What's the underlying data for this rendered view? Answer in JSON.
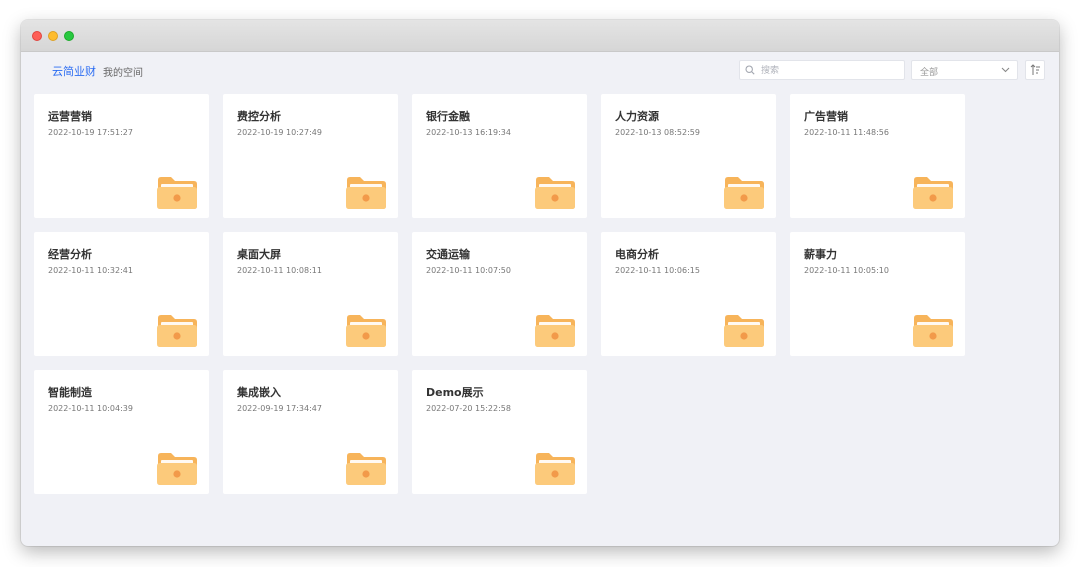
{
  "header": {
    "brand": "云简业财",
    "space": "我的空间",
    "search_placeholder": "搜索",
    "filter_value": "全部"
  },
  "icons": {
    "search": "search-icon",
    "dropdown": "chevron-down-icon",
    "sort": "sort-icon",
    "folder": "folder-icon"
  },
  "colors": {
    "brand": "#2c6df2",
    "folder": "#fbc56f"
  },
  "folders": [
    {
      "name": "运营营销",
      "time": "2022-10-19 17:51:27"
    },
    {
      "name": "费控分析",
      "time": "2022-10-19 10:27:49"
    },
    {
      "name": "银行金融",
      "time": "2022-10-13 16:19:34"
    },
    {
      "name": "人力资源",
      "time": "2022-10-13 08:52:59"
    },
    {
      "name": "广告营销",
      "time": "2022-10-11 11:48:56"
    },
    {
      "name": "经营分析",
      "time": "2022-10-11 10:32:41"
    },
    {
      "name": "桌面大屏",
      "time": "2022-10-11 10:08:11"
    },
    {
      "name": "交通运输",
      "time": "2022-10-11 10:07:50"
    },
    {
      "name": "电商分析",
      "time": "2022-10-11 10:06:15"
    },
    {
      "name": "薪事力",
      "time": "2022-10-11 10:05:10"
    },
    {
      "name": "智能制造",
      "time": "2022-10-11 10:04:39"
    },
    {
      "name": "集成嵌入",
      "time": "2022-09-19 17:34:47"
    },
    {
      "name": "Demo展示",
      "time": "2022-07-20 15:22:58"
    }
  ]
}
